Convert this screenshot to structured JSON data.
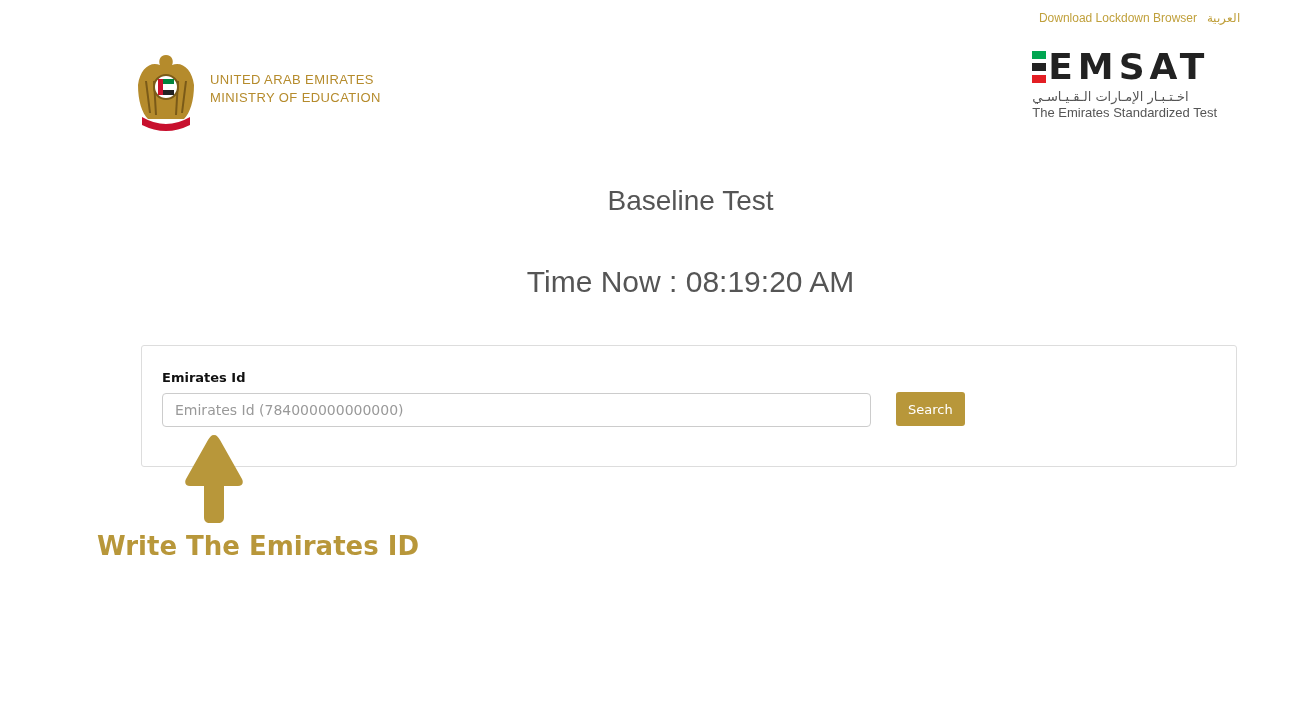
{
  "top_links": [
    {
      "label": "Download Lockdown Browser"
    },
    {
      "label": "العربية"
    }
  ],
  "ministry_logo": {
    "line_1": "UNITED ARAB EMIRATES",
    "line_2": "MINISTRY OF EDUCATION"
  },
  "emsat_logo": {
    "wordmark": "EMSAT",
    "arabic": "اخـتـبـار الإمـارات الـقـيـاسـي",
    "tagline": "The Emirates Standardized Test"
  },
  "title": "Baseline Test",
  "time_now": "Time Now : 08:19:20 AM",
  "form": {
    "label": "Emirates Id",
    "placeholder": "Emirates Id (784000000000000)",
    "button": "Search"
  },
  "annotation": "Write The Emirates ID"
}
